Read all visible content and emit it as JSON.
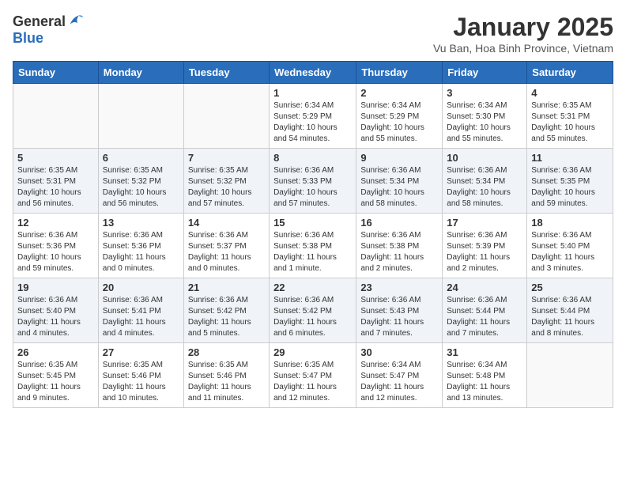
{
  "logo": {
    "general": "General",
    "blue": "Blue"
  },
  "title": "January 2025",
  "subtitle": "Vu Ban, Hoa Binh Province, Vietnam",
  "days_of_week": [
    "Sunday",
    "Monday",
    "Tuesday",
    "Wednesday",
    "Thursday",
    "Friday",
    "Saturday"
  ],
  "weeks": [
    [
      {
        "day": "",
        "info": ""
      },
      {
        "day": "",
        "info": ""
      },
      {
        "day": "",
        "info": ""
      },
      {
        "day": "1",
        "info": "Sunrise: 6:34 AM\nSunset: 5:29 PM\nDaylight: 10 hours\nand 54 minutes."
      },
      {
        "day": "2",
        "info": "Sunrise: 6:34 AM\nSunset: 5:29 PM\nDaylight: 10 hours\nand 55 minutes."
      },
      {
        "day": "3",
        "info": "Sunrise: 6:34 AM\nSunset: 5:30 PM\nDaylight: 10 hours\nand 55 minutes."
      },
      {
        "day": "4",
        "info": "Sunrise: 6:35 AM\nSunset: 5:31 PM\nDaylight: 10 hours\nand 55 minutes."
      }
    ],
    [
      {
        "day": "5",
        "info": "Sunrise: 6:35 AM\nSunset: 5:31 PM\nDaylight: 10 hours\nand 56 minutes."
      },
      {
        "day": "6",
        "info": "Sunrise: 6:35 AM\nSunset: 5:32 PM\nDaylight: 10 hours\nand 56 minutes."
      },
      {
        "day": "7",
        "info": "Sunrise: 6:35 AM\nSunset: 5:32 PM\nDaylight: 10 hours\nand 57 minutes."
      },
      {
        "day": "8",
        "info": "Sunrise: 6:36 AM\nSunset: 5:33 PM\nDaylight: 10 hours\nand 57 minutes."
      },
      {
        "day": "9",
        "info": "Sunrise: 6:36 AM\nSunset: 5:34 PM\nDaylight: 10 hours\nand 58 minutes."
      },
      {
        "day": "10",
        "info": "Sunrise: 6:36 AM\nSunset: 5:34 PM\nDaylight: 10 hours\nand 58 minutes."
      },
      {
        "day": "11",
        "info": "Sunrise: 6:36 AM\nSunset: 5:35 PM\nDaylight: 10 hours\nand 59 minutes."
      }
    ],
    [
      {
        "day": "12",
        "info": "Sunrise: 6:36 AM\nSunset: 5:36 PM\nDaylight: 10 hours\nand 59 minutes."
      },
      {
        "day": "13",
        "info": "Sunrise: 6:36 AM\nSunset: 5:36 PM\nDaylight: 11 hours\nand 0 minutes."
      },
      {
        "day": "14",
        "info": "Sunrise: 6:36 AM\nSunset: 5:37 PM\nDaylight: 11 hours\nand 0 minutes."
      },
      {
        "day": "15",
        "info": "Sunrise: 6:36 AM\nSunset: 5:38 PM\nDaylight: 11 hours\nand 1 minute."
      },
      {
        "day": "16",
        "info": "Sunrise: 6:36 AM\nSunset: 5:38 PM\nDaylight: 11 hours\nand 2 minutes."
      },
      {
        "day": "17",
        "info": "Sunrise: 6:36 AM\nSunset: 5:39 PM\nDaylight: 11 hours\nand 2 minutes."
      },
      {
        "day": "18",
        "info": "Sunrise: 6:36 AM\nSunset: 5:40 PM\nDaylight: 11 hours\nand 3 minutes."
      }
    ],
    [
      {
        "day": "19",
        "info": "Sunrise: 6:36 AM\nSunset: 5:40 PM\nDaylight: 11 hours\nand 4 minutes."
      },
      {
        "day": "20",
        "info": "Sunrise: 6:36 AM\nSunset: 5:41 PM\nDaylight: 11 hours\nand 4 minutes."
      },
      {
        "day": "21",
        "info": "Sunrise: 6:36 AM\nSunset: 5:42 PM\nDaylight: 11 hours\nand 5 minutes."
      },
      {
        "day": "22",
        "info": "Sunrise: 6:36 AM\nSunset: 5:42 PM\nDaylight: 11 hours\nand 6 minutes."
      },
      {
        "day": "23",
        "info": "Sunrise: 6:36 AM\nSunset: 5:43 PM\nDaylight: 11 hours\nand 7 minutes."
      },
      {
        "day": "24",
        "info": "Sunrise: 6:36 AM\nSunset: 5:44 PM\nDaylight: 11 hours\nand 7 minutes."
      },
      {
        "day": "25",
        "info": "Sunrise: 6:36 AM\nSunset: 5:44 PM\nDaylight: 11 hours\nand 8 minutes."
      }
    ],
    [
      {
        "day": "26",
        "info": "Sunrise: 6:35 AM\nSunset: 5:45 PM\nDaylight: 11 hours\nand 9 minutes."
      },
      {
        "day": "27",
        "info": "Sunrise: 6:35 AM\nSunset: 5:46 PM\nDaylight: 11 hours\nand 10 minutes."
      },
      {
        "day": "28",
        "info": "Sunrise: 6:35 AM\nSunset: 5:46 PM\nDaylight: 11 hours\nand 11 minutes."
      },
      {
        "day": "29",
        "info": "Sunrise: 6:35 AM\nSunset: 5:47 PM\nDaylight: 11 hours\nand 12 minutes."
      },
      {
        "day": "30",
        "info": "Sunrise: 6:34 AM\nSunset: 5:47 PM\nDaylight: 11 hours\nand 12 minutes."
      },
      {
        "day": "31",
        "info": "Sunrise: 6:34 AM\nSunset: 5:48 PM\nDaylight: 11 hours\nand 13 minutes."
      },
      {
        "day": "",
        "info": ""
      }
    ]
  ]
}
